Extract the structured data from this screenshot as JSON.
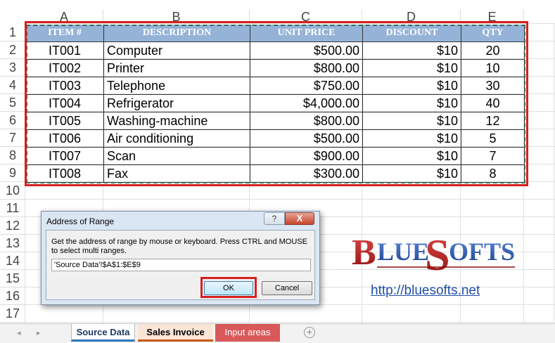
{
  "columns": [
    "A",
    "B",
    "C",
    "D",
    "E"
  ],
  "rows": [
    "1",
    "2",
    "3",
    "4",
    "5",
    "6",
    "7",
    "8",
    "9",
    "10",
    "11",
    "12",
    "13",
    "14",
    "15",
    "16",
    "17"
  ],
  "table": {
    "headers": [
      "ITEM #",
      "DESCRIPTION",
      "UNIT PRICE",
      "DISCOUNT",
      "QTY"
    ],
    "rows": [
      [
        "IT001",
        "Computer",
        "$500.00",
        "$10",
        "20"
      ],
      [
        "IT002",
        "Printer",
        "$800.00",
        "$10",
        "10"
      ],
      [
        "IT003",
        "Telephone",
        "$750.00",
        "$10",
        "30"
      ],
      [
        "IT004",
        "Refrigerator",
        "$4,000.00",
        "$10",
        "40"
      ],
      [
        "IT005",
        "Washing-machine",
        "$800.00",
        "$10",
        "12"
      ],
      [
        "IT006",
        "Air conditioning",
        "$500.00",
        "$10",
        "5"
      ],
      [
        "IT007",
        "Scan",
        "$900.00",
        "$10",
        "7"
      ],
      [
        "IT008",
        "Fax",
        "$300.00",
        "$10",
        "8"
      ]
    ],
    "header_color": "#95b3d7"
  },
  "dialog": {
    "title": "Address of Range",
    "help_label": "?",
    "close_label": "X",
    "message": "Get the address of range by mouse or keyboard. Press CTRL and MOUSE to select multi ranges.",
    "range_value": "'Source Data'!$A$1:$E$9",
    "ok_label": "OK",
    "cancel_label": "Cancel"
  },
  "logo": {
    "brand": "BLUESOFTS",
    "url": "http://bluesofts.net"
  },
  "sheets": {
    "tabs": [
      "Source Data",
      "Sales Invoice",
      "Input areas"
    ],
    "active": "Source Data",
    "add_icon": "plus-circle-icon",
    "prev_icon": "◂",
    "next_icon": "▸"
  },
  "colors": {
    "highlight": "#d62020",
    "accent": "#2e75b6"
  }
}
